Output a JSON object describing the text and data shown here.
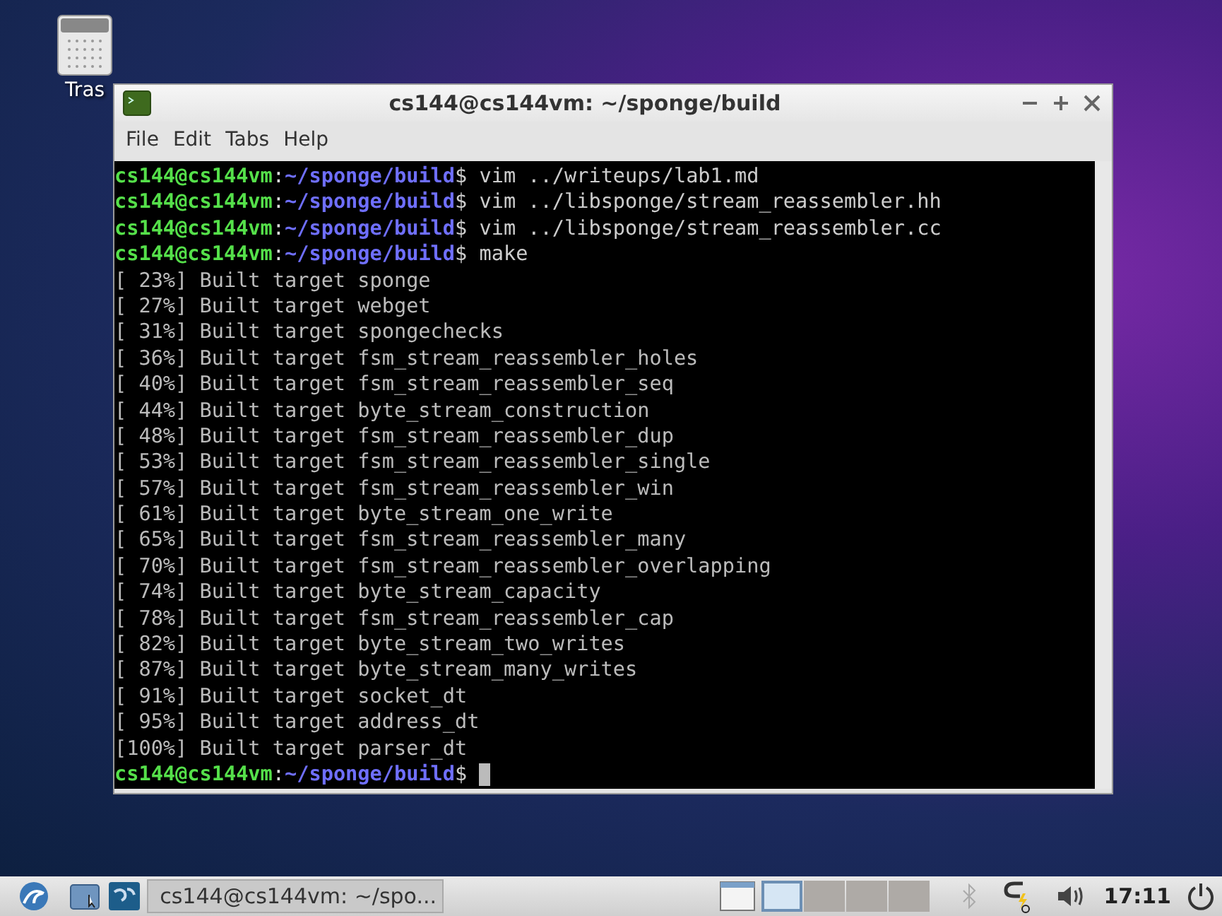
{
  "desktop_icons": [
    {
      "label": "Tras"
    }
  ],
  "window": {
    "title": "cs144@cs144vm: ~/sponge/build",
    "menu": [
      "File",
      "Edit",
      "Tabs",
      "Help"
    ],
    "lines": [
      {
        "kind": "prompt",
        "user": "cs144@cs144vm",
        "sep": ":",
        "path": "~/sponge/build",
        "command": "$ vim ../writeups/lab1.md",
        "cursor": false
      },
      {
        "kind": "prompt",
        "user": "cs144@cs144vm",
        "sep": ":",
        "path": "~/sponge/build",
        "command": "$ vim ../libsponge/stream_reassembler.hh",
        "cursor": false
      },
      {
        "kind": "prompt",
        "user": "cs144@cs144vm",
        "sep": ":",
        "path": "~/sponge/build",
        "command": "$ vim ../libsponge/stream_reassembler.cc",
        "cursor": false
      },
      {
        "kind": "prompt",
        "user": "cs144@cs144vm",
        "sep": ":",
        "path": "~/sponge/build",
        "command": "$ make",
        "cursor": false
      },
      {
        "kind": "output",
        "text": "[ 23%] Built target sponge"
      },
      {
        "kind": "output",
        "text": "[ 27%] Built target webget"
      },
      {
        "kind": "output",
        "text": "[ 31%] Built target spongechecks"
      },
      {
        "kind": "output",
        "text": "[ 36%] Built target fsm_stream_reassembler_holes"
      },
      {
        "kind": "output",
        "text": "[ 40%] Built target fsm_stream_reassembler_seq"
      },
      {
        "kind": "output",
        "text": "[ 44%] Built target byte_stream_construction"
      },
      {
        "kind": "output",
        "text": "[ 48%] Built target fsm_stream_reassembler_dup"
      },
      {
        "kind": "output",
        "text": "[ 53%] Built target fsm_stream_reassembler_single"
      },
      {
        "kind": "output",
        "text": "[ 57%] Built target fsm_stream_reassembler_win"
      },
      {
        "kind": "output",
        "text": "[ 61%] Built target byte_stream_one_write"
      },
      {
        "kind": "output",
        "text": "[ 65%] Built target fsm_stream_reassembler_many"
      },
      {
        "kind": "output",
        "text": "[ 70%] Built target fsm_stream_reassembler_overlapping"
      },
      {
        "kind": "output",
        "text": "[ 74%] Built target byte_stream_capacity"
      },
      {
        "kind": "output",
        "text": "[ 78%] Built target fsm_stream_reassembler_cap"
      },
      {
        "kind": "output",
        "text": "[ 82%] Built target byte_stream_two_writes"
      },
      {
        "kind": "output",
        "text": "[ 87%] Built target byte_stream_many_writes"
      },
      {
        "kind": "output",
        "text": "[ 91%] Built target socket_dt"
      },
      {
        "kind": "output",
        "text": "[ 95%] Built target address_dt"
      },
      {
        "kind": "output",
        "text": "[100%] Built target parser_dt"
      },
      {
        "kind": "prompt",
        "user": "cs144@cs144vm",
        "sep": ":",
        "path": "~/sponge/build",
        "command": "$ ",
        "cursor": true
      }
    ]
  },
  "taskbar": {
    "task": "cs144@cs144vm: ~/spo...",
    "workspaces": [
      {
        "selected": true
      },
      {
        "selected": false
      },
      {
        "selected": false
      },
      {
        "selected": false
      }
    ],
    "clock": "17:11"
  }
}
